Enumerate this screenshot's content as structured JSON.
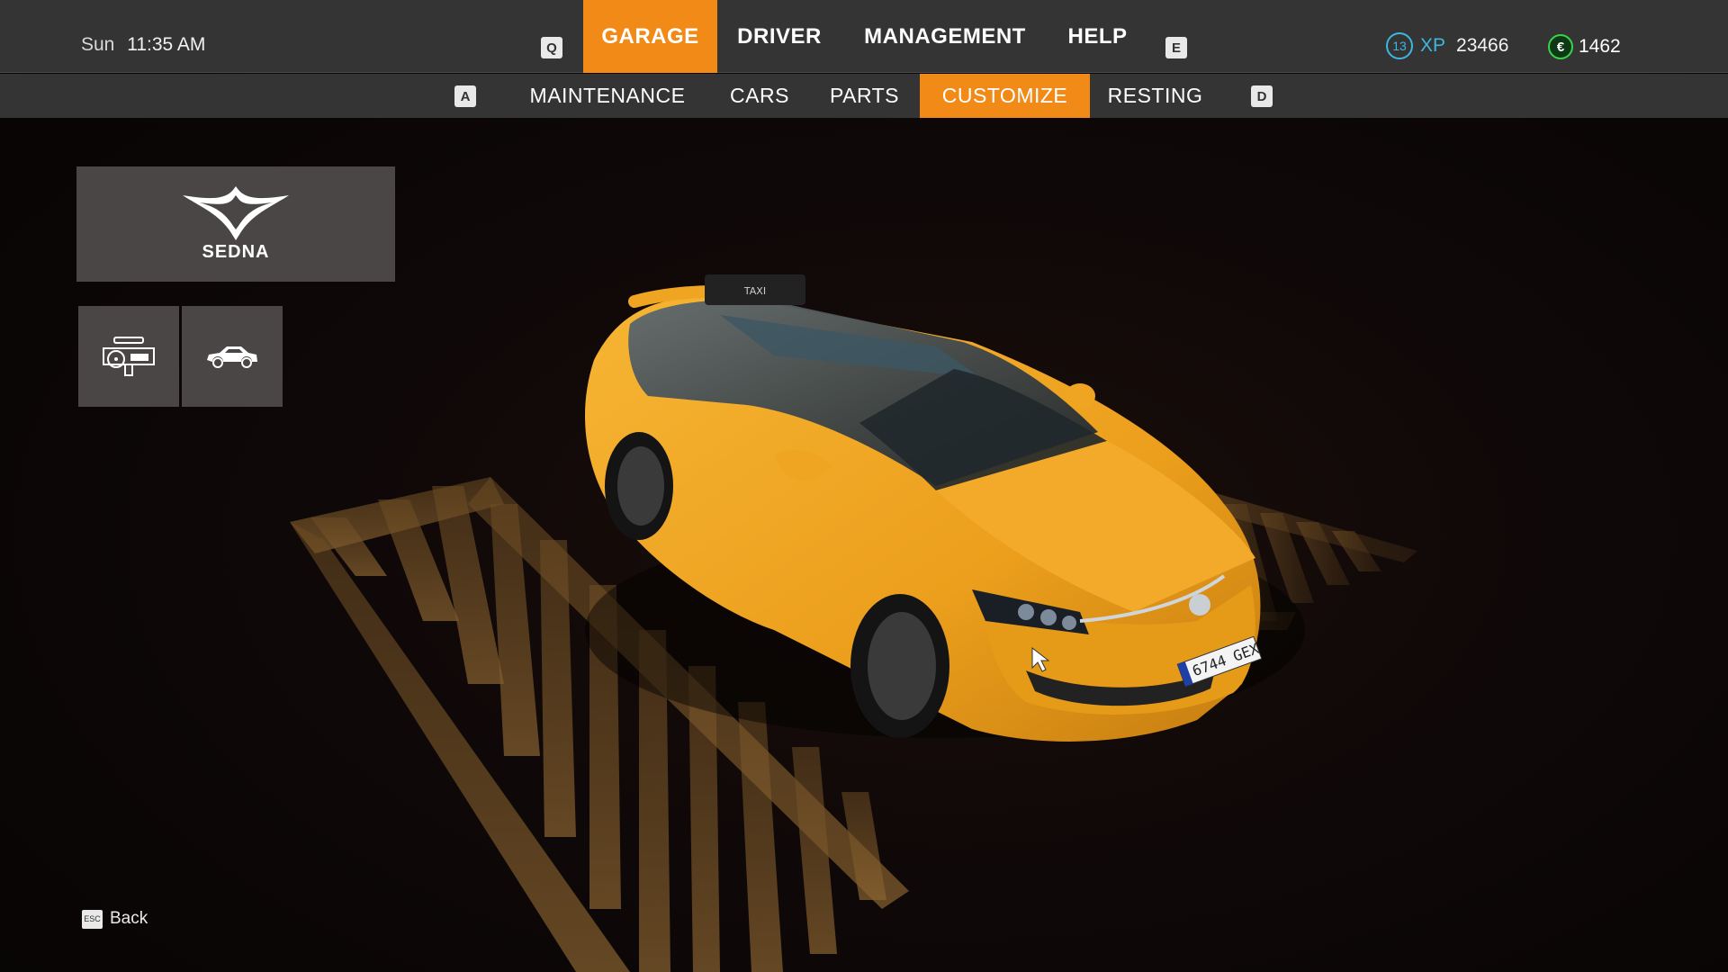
{
  "status": {
    "day": "Sun",
    "time": "11:35 AM"
  },
  "main_nav": {
    "prev_key": "Q",
    "next_key": "E",
    "tabs": [
      {
        "label": "GARAGE",
        "active": true
      },
      {
        "label": "DRIVER",
        "active": false
      },
      {
        "label": "MANAGEMENT",
        "active": false
      },
      {
        "label": "HELP",
        "active": false
      }
    ]
  },
  "player": {
    "level": "13",
    "xp_label": "XP",
    "xp_value": "23466",
    "currency_icon": "€",
    "money": "1462"
  },
  "sub_nav": {
    "prev_key": "A",
    "next_key": "D",
    "tabs": [
      {
        "label": "MAINTENANCE",
        "active": false
      },
      {
        "label": "CARS",
        "active": false
      },
      {
        "label": "PARTS",
        "active": false
      },
      {
        "label": "CUSTOMIZE",
        "active": true
      },
      {
        "label": "RESTING",
        "active": false
      }
    ]
  },
  "brand": {
    "name": "SEDNA",
    "logo_icon": "sedna-logo"
  },
  "view_buttons": [
    {
      "icon": "interior-view-icon"
    },
    {
      "icon": "exterior-view-icon"
    }
  ],
  "car": {
    "roof_sign": "TAXI",
    "plate": "6744 GEX",
    "color": "#f0a824"
  },
  "footer": {
    "key": "ESC",
    "back_label": "Back"
  },
  "colors": {
    "accent": "#f18a16",
    "bar": "#343434",
    "xp": "#3fb6e0",
    "money": "#3ad24a"
  }
}
